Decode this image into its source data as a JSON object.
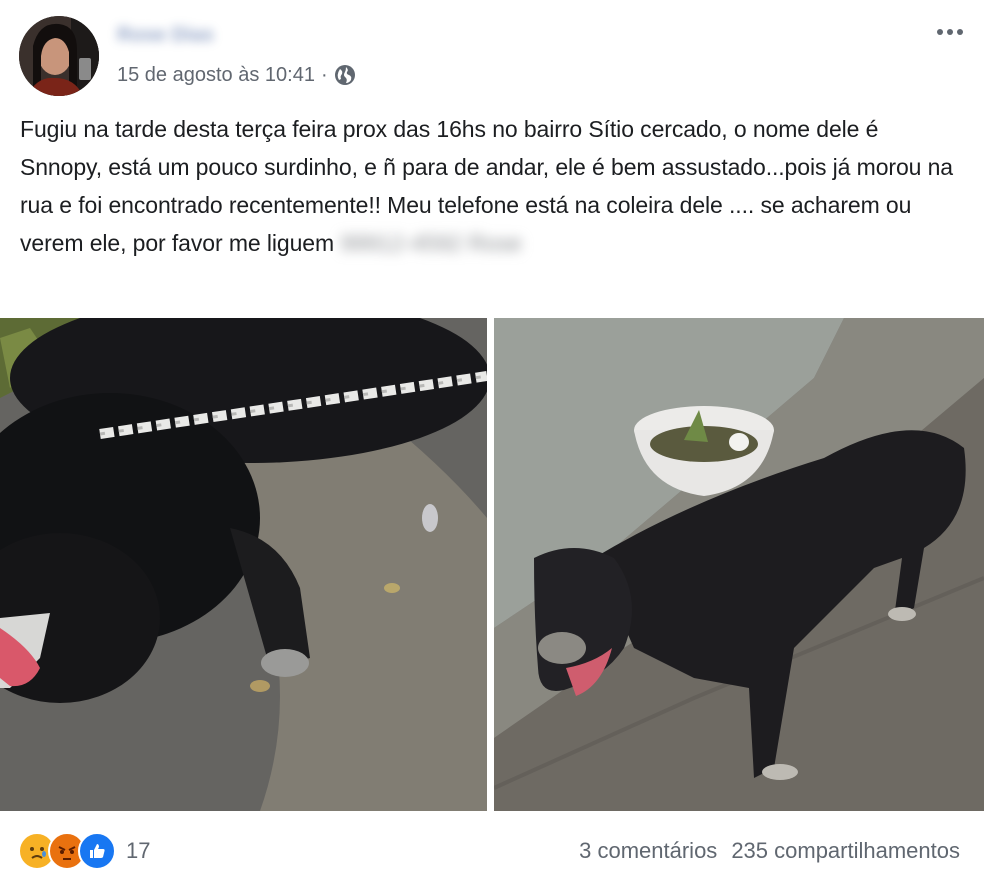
{
  "post": {
    "author": "Rose Dias",
    "date": "15 de agosto às 10:41",
    "separator": "·",
    "privacy_icon": "globe-icon",
    "menu_icon": "more-options-icon",
    "text": "Fugiu na tarde desta terça feira prox das 16hs no bairro Sítio cercado, o nome dele é Snnopy, está um pouco surdinho, e ñ para de andar, ele é bem assustado...pois já morou na rua e foi encontrado recentemente!! Meu telefone está na coleira dele .... se acharem ou verem ele, por favor me liguem",
    "phone": "99912-4592 Rose"
  },
  "photos": {
    "left_icon": "dog-on-chain-photo",
    "right_icon": "dog-beside-pot-photo"
  },
  "footer": {
    "reactions": [
      "sad-icon",
      "angry-icon",
      "like-icon"
    ],
    "reaction_count": "17",
    "comments": "3 comentários",
    "shares": "235 compartilhamentos"
  },
  "colors": {
    "link": "#385898",
    "meta": "#616770",
    "like": "#1877f2",
    "sad": "#f7b125",
    "angry": "#e9710f"
  }
}
